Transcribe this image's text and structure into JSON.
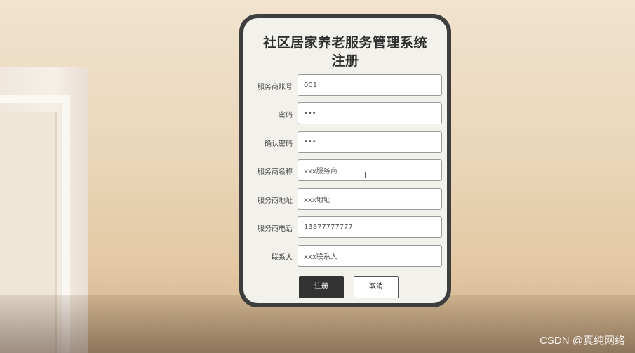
{
  "form": {
    "title": "社区居家养老服务管理系统注册",
    "fields": [
      {
        "label": "服务商账号",
        "value": "001"
      },
      {
        "label": "密码",
        "value": "•••"
      },
      {
        "label": "确认密码",
        "value": "•••"
      },
      {
        "label": "服务商名称",
        "value": "xxx服务商"
      },
      {
        "label": "服务商地址",
        "value": "xxx地址"
      },
      {
        "label": "服务商电话",
        "value": "13877777777"
      },
      {
        "label": "联系人",
        "value": "xxx联系人"
      }
    ],
    "register_label": "注册",
    "cancel_label": "取消"
  },
  "cursor_icon": "text-cursor-icon",
  "watermark": "CSDN @真纯网络",
  "colors": {
    "card_border": "#3e3e3e",
    "card_bg": "#f3f1eb",
    "primary_button": "#333333"
  }
}
